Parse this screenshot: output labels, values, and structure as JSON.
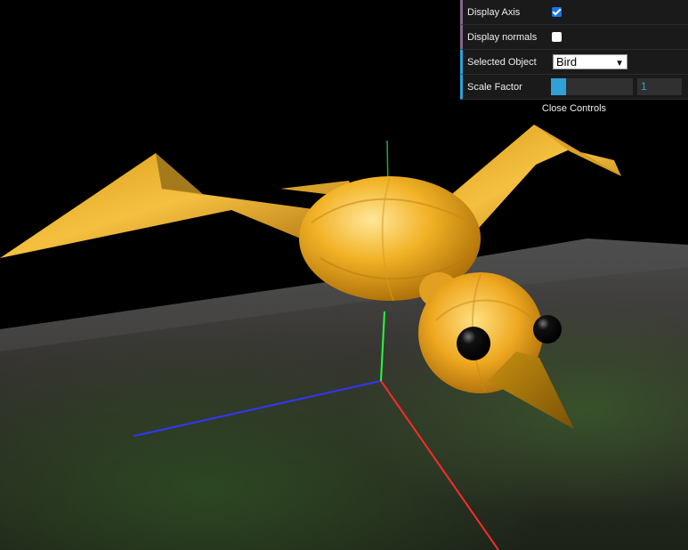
{
  "gui": {
    "controls": [
      {
        "label": "Display Axis",
        "type": "checkbox",
        "checked": true
      },
      {
        "label": "Display normals",
        "type": "checkbox",
        "checked": false
      },
      {
        "label": "Selected Object",
        "type": "select",
        "value": "Bird"
      },
      {
        "label": "Scale Factor",
        "type": "slider",
        "value": "1",
        "fraction": 0.18
      }
    ],
    "close_label": "Close Controls"
  },
  "scene": {
    "axis_colors": {
      "x": "#ff2020",
      "y": "#20ff40",
      "z": "#3030ff"
    },
    "bird_color": "#e8a810",
    "eye_color": "#000000"
  }
}
